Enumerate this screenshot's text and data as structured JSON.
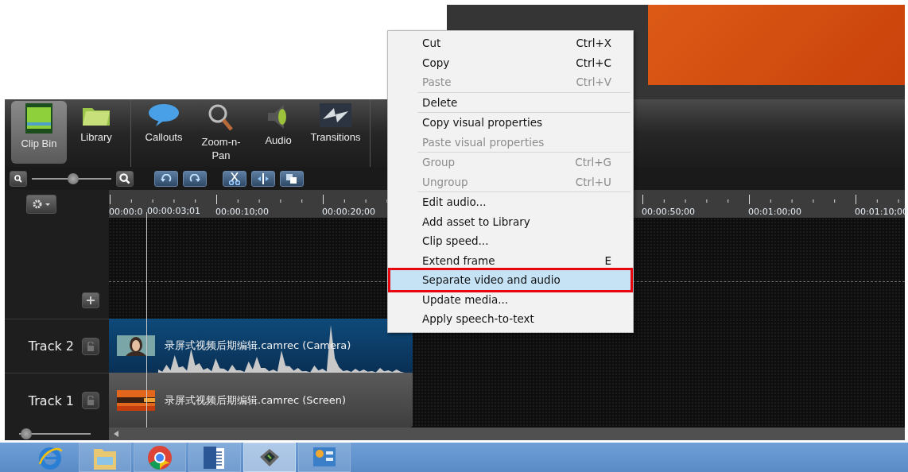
{
  "toolbar": {
    "tabs": [
      {
        "label": "Clip Bin",
        "selected": true
      },
      {
        "label": "Library",
        "selected": false
      },
      {
        "label": "Callouts",
        "selected": false
      },
      {
        "label": "Zoom-n-Pan",
        "selected": false
      },
      {
        "label": "Audio",
        "selected": false
      },
      {
        "label": "Transitions",
        "selected": false
      }
    ]
  },
  "zoom_slider": {
    "level": 0.52
  },
  "timeline": {
    "ruler": [
      "00:00:0",
      "00:00:10;00",
      "00:00:20;00",
      "00:00:50;00",
      "00:01:00;00",
      "00:01:10;00"
    ],
    "playhead_time": "00:00:03;01",
    "tracks": [
      {
        "name": "Track 2",
        "kind": "camera",
        "clip": "录屏式视频后期编辑.camrec (Camera)",
        "locked": false
      },
      {
        "name": "Track 1",
        "kind": "screen",
        "clip": "录屏式视频后期编辑.camrec (Screen)",
        "locked": false
      }
    ],
    "height_slider": {
      "level": 0.1
    }
  },
  "context_menu": {
    "groups": [
      [
        {
          "label": "Cut",
          "shortcut": "Ctrl+X",
          "disabled": false,
          "selected": false
        },
        {
          "label": "Copy",
          "shortcut": "Ctrl+C",
          "disabled": false,
          "selected": false
        },
        {
          "label": "Paste",
          "shortcut": "Ctrl+V",
          "disabled": true,
          "selected": false
        }
      ],
      [
        {
          "label": "Delete",
          "disabled": false,
          "selected": false
        }
      ],
      [
        {
          "label": "Copy visual properties",
          "disabled": false,
          "selected": false
        },
        {
          "label": "Paste visual properties",
          "disabled": true,
          "selected": false
        }
      ],
      [
        {
          "label": "Group",
          "shortcut": "Ctrl+G",
          "disabled": true,
          "selected": false
        },
        {
          "label": "Ungroup",
          "shortcut": "Ctrl+U",
          "disabled": true,
          "selected": false
        }
      ],
      [
        {
          "label": "Edit audio...",
          "disabled": false,
          "selected": false
        },
        {
          "label": "Add asset to Library",
          "disabled": false,
          "selected": false
        },
        {
          "label": "Clip speed...",
          "disabled": false,
          "selected": false
        },
        {
          "label": "Extend frame",
          "shortcut": "E",
          "disabled": false,
          "selected": false
        },
        {
          "label": "Separate video and audio",
          "disabled": false,
          "selected": true
        },
        {
          "label": "Update media...",
          "disabled": false,
          "selected": false
        },
        {
          "label": "Apply speech-to-text",
          "disabled": false,
          "selected": false
        }
      ]
    ]
  },
  "taskbar": [
    {
      "selected": false
    },
    {
      "selected": false
    },
    {
      "selected": false
    },
    {
      "selected": false
    },
    {
      "selected": true
    },
    {
      "selected": false
    }
  ]
}
